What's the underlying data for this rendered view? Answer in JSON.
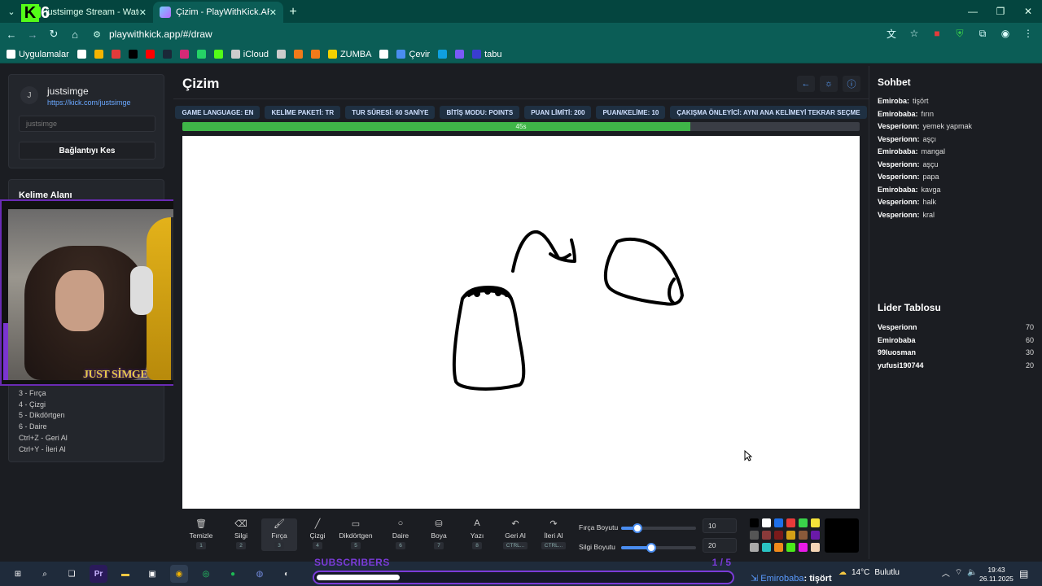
{
  "browser": {
    "tabs": [
      {
        "title": "justsimge Stream - Watch Live on Kick",
        "active": false
      },
      {
        "title": "Çizim - PlayWithKick.APP",
        "active": true
      }
    ],
    "overlay_logo": {
      "letter": "K",
      "number": "6"
    },
    "url": "playwithkick.app/#/draw",
    "bookmarks": [
      {
        "label": "Uygulamalar",
        "icon": "grid-icon",
        "color": "#ffffff"
      },
      {
        "label": "",
        "icon": "apps-icon",
        "color": "#ffffff"
      },
      {
        "label": "",
        "icon": "color-app-icon",
        "color": "#f4b400"
      },
      {
        "label": "",
        "icon": "red-app-icon",
        "color": "#e23b3b"
      },
      {
        "label": "",
        "icon": "tiktok-icon",
        "color": "#000000"
      },
      {
        "label": "",
        "icon": "youtube-icon",
        "color": "#ff0000"
      },
      {
        "label": "",
        "icon": "steam-icon",
        "color": "#1b2838"
      },
      {
        "label": "",
        "icon": "instagram-icon",
        "color": "#d62976"
      },
      {
        "label": "",
        "icon": "whatsapp-icon",
        "color": "#25d366"
      },
      {
        "label": "",
        "icon": "kick-icon",
        "color": "#53fc18"
      },
      {
        "label": "iCloud",
        "icon": "apple-icon",
        "color": "#cccccc"
      },
      {
        "label": "",
        "icon": "feather-icon",
        "color": "#cccccc"
      },
      {
        "label": "",
        "icon": "hb-icon",
        "color": "#f27a1a"
      },
      {
        "label": "",
        "icon": "circle-app-icon",
        "color": "#f27a1a"
      },
      {
        "label": "ZUMBA",
        "icon": "zumba-icon",
        "color": "#f3d000"
      },
      {
        "label": "",
        "icon": "chatgpt-icon",
        "color": "#ffffff"
      },
      {
        "label": "Çevir",
        "icon": "translate-icon",
        "color": "#4a8df0"
      },
      {
        "label": "",
        "icon": "edge-icon",
        "color": "#0fa0e0"
      },
      {
        "label": "",
        "icon": "purple-app-icon",
        "color": "#7a5af8"
      },
      {
        "label": "tabu",
        "icon": "tabu-icon",
        "color": "#3a3dd0"
      }
    ]
  },
  "profile": {
    "avatar_letter": "J",
    "username": "justsimge",
    "link": "https://kick.com/justsimge",
    "input_placeholder": "justsimge",
    "disconnect_label": "Bağlantıyı Kes"
  },
  "word_area": {
    "heading": "Kelime Alanı",
    "shortcuts": [
      "3 - Fırça",
      "4 - Çizgi",
      "5 - Dikdörtgen",
      "6 - Daire",
      "Ctrl+Z - Geri Al",
      "Ctrl+Y - İleri Al"
    ]
  },
  "webcam": {
    "label": "JUST SİMGE"
  },
  "main": {
    "title": "Çizim",
    "tags": [
      "GAME LANGUAGE: EN",
      "KELİME PAKETİ: TR",
      "TUR SÜRESİ: 60 SANİYE",
      "BİTİŞ MODU: POINTS",
      "PUAN LİMİTİ: 200",
      "PUAN/KELİME: 10",
      "ÇAKIŞMA ÖNLEYİCİ: AYNI ANA KELİMEYİ TEKRAR SEÇME"
    ],
    "timer_text": "45s",
    "timer_fraction": 0.75
  },
  "toolbar": {
    "tools": [
      {
        "label": "Temizle",
        "key": "1",
        "icon": "trash-icon",
        "glyph": "🗑"
      },
      {
        "label": "Silgi",
        "key": "2",
        "icon": "eraser-icon",
        "glyph": "⌫"
      },
      {
        "label": "Fırça",
        "key": "3",
        "icon": "brush-icon",
        "glyph": "🖌",
        "active": true
      },
      {
        "label": "Çizgi",
        "key": "4",
        "icon": "line-icon",
        "glyph": "╱"
      },
      {
        "label": "Dikdörtgen",
        "key": "5",
        "icon": "rectangle-icon",
        "glyph": "▭"
      },
      {
        "label": "Daire",
        "key": "6",
        "icon": "circle-icon",
        "glyph": "○"
      },
      {
        "label": "Boya",
        "key": "7",
        "icon": "bucket-icon",
        "glyph": "⛁"
      },
      {
        "label": "Yazı",
        "key": "8",
        "icon": "text-icon",
        "glyph": "A"
      },
      {
        "label": "Geri Al",
        "key": "CTRL...",
        "icon": "undo-icon",
        "glyph": "↶"
      },
      {
        "label": "İleri Al",
        "key": "CTRL...",
        "icon": "redo-icon",
        "glyph": "↷"
      }
    ],
    "brush_size_label": "Fırça Boyutu",
    "brush_size": "10",
    "brush_fraction": 0.22,
    "eraser_size_label": "Silgi Boyutu",
    "eraser_size": "20",
    "eraser_fraction": 0.4,
    "palette": [
      "#000000",
      "#ffffff",
      "#1e6fe8",
      "#e83a3a",
      "#3ad24a",
      "#f5e33a",
      "#555555",
      "#8a3a3a",
      "#7a1a1a",
      "#d4a017",
      "#8a5a3a",
      "#6a1aa8",
      "#aaaaaa",
      "#2ac4c4",
      "#f08a1a",
      "#4ae81a",
      "#e81ae8",
      "#f5d5b5"
    ],
    "selected_color": "#000000"
  },
  "chat": {
    "title": "Sohbet",
    "messages": [
      {
        "user": "Emiroba:",
        "text": "tişört"
      },
      {
        "user": "Emirobaba:",
        "text": "fırın"
      },
      {
        "user": "Vesperionn:",
        "text": "yemek yapmak"
      },
      {
        "user": "Vesperionn:",
        "text": "aşçı"
      },
      {
        "user": "Emirobaba:",
        "text": "mangal"
      },
      {
        "user": "Vesperionn:",
        "text": "aşçu"
      },
      {
        "user": "Vesperionn:",
        "text": "papa"
      },
      {
        "user": "Emirobaba:",
        "text": "kavga"
      },
      {
        "user": "Vesperionn:",
        "text": "halk"
      },
      {
        "user": "Vesperionn:",
        "text": "kral"
      }
    ]
  },
  "leaderboard": {
    "title": "Lider Tablosu",
    "rows": [
      {
        "name": "Vesperionn",
        "score": "70"
      },
      {
        "name": "Emirobaba",
        "score": "60"
      },
      {
        "name": "99luosman",
        "score": "30"
      },
      {
        "name": "yufusi190744",
        "score": "20"
      }
    ]
  },
  "stream_overlay": {
    "subs_label": "SUBSCRIBERS",
    "subs_count": "1 / 5",
    "subs_fraction": 0.2,
    "last_guess_user": "Emirobaba",
    "last_guess_word": ": tişört"
  },
  "taskbar": {
    "weather_temp": "14°C",
    "weather_desc": "Bulutlu",
    "time": "19:43",
    "date": "26.11.2025",
    "weather_badge": "1"
  }
}
